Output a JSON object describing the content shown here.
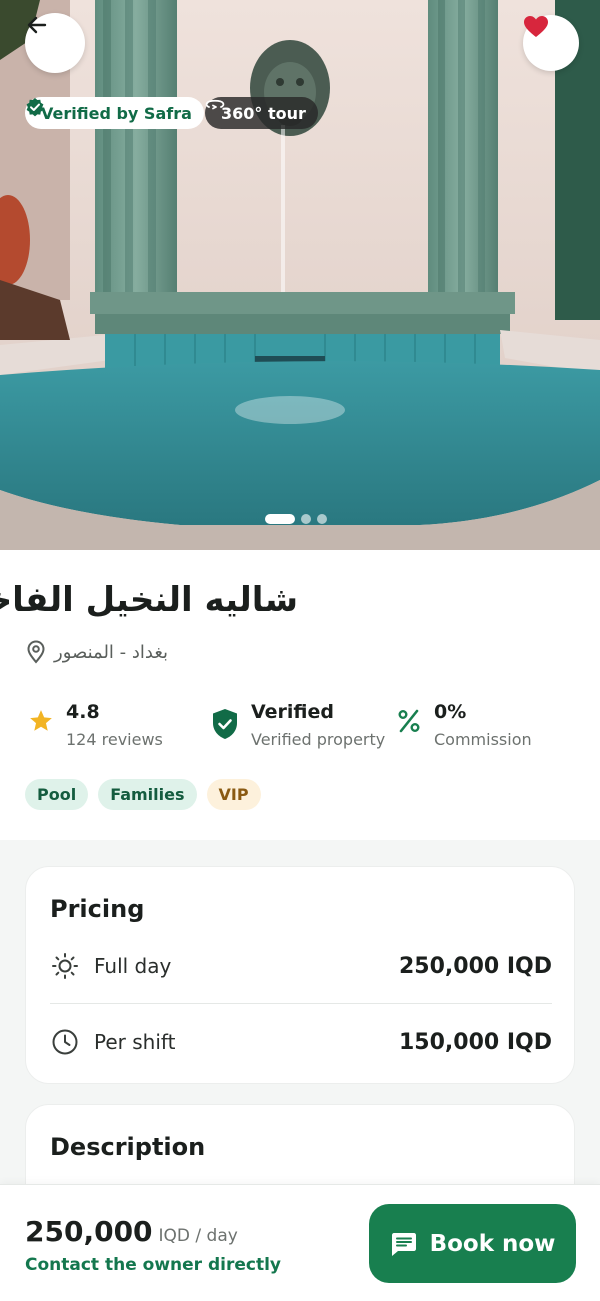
{
  "hero": {
    "badge_verified": "Verified by Safra",
    "badge_tour": "360° tour",
    "slides": 3,
    "active_slide": 1
  },
  "listing": {
    "title": "شاليه النخيل الفاخر",
    "location": "بغداد - المنصور",
    "rating": "4.8",
    "reviews": "124 reviews",
    "verified_title": "Verified",
    "verified_sub": "Verified property",
    "commission_value": "0%",
    "commission_label": "Commission",
    "tags": [
      "Pool",
      "Families",
      "VIP"
    ]
  },
  "pricing": {
    "title": "Pricing",
    "full_day_label": "Full day",
    "full_day_value": "250,000 IQD",
    "per_shift_label": "Per shift",
    "per_shift_value": "150,000 IQD"
  },
  "description": {
    "title": "Description"
  },
  "bottom": {
    "amount": "250,000",
    "unit": "IQD / day",
    "contact": "Contact the owner directly",
    "book_label": "Book now"
  },
  "colors": {
    "brand_green": "#187f4f",
    "verified_green": "#116b47",
    "star": "#f2b424",
    "heart": "#d7263d"
  },
  "icons": [
    "arrow-left-icon",
    "heart-icon",
    "verified-check-icon",
    "360-tour-icon",
    "location-pin-icon",
    "star-icon",
    "shield-check-icon",
    "percent-icon",
    "sun-icon",
    "clock-icon",
    "chat-icon"
  ]
}
